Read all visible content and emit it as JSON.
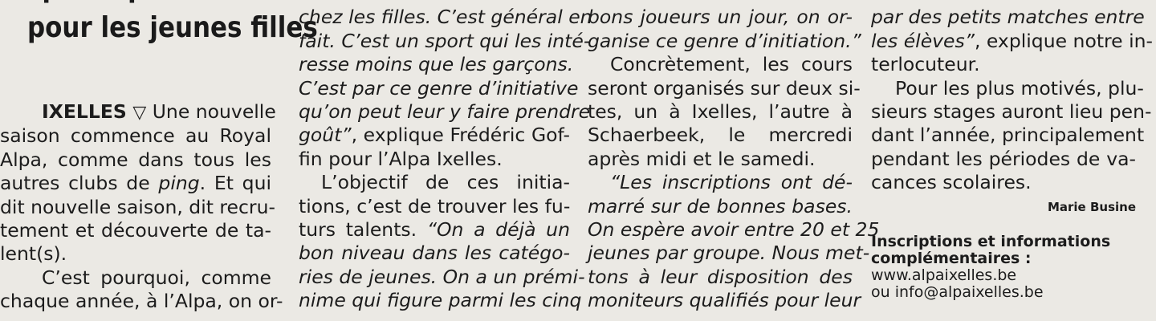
{
  "headline": [
    "spécifiques",
    "pour les jeunes filles"
  ],
  "col1": {
    "location": "IXELLES",
    "location_symbol": "▽",
    "lead_rest": " Une nouvelle",
    "lines": [
      "saison commence au Royal",
      "Alpa, comme dans tous les"
    ],
    "line_ping_pre": "autres clubs de ",
    "line_ping_em": "ping",
    "line_ping_post": ". Et qui",
    "lines2": [
      "dit nouvelle saison, dit recru-",
      "tement et découverte de ta-",
      "lent(s)."
    ],
    "para2": [
      "C’est pourquoi, comme",
      "chaque année, à l’Alpa, on or-"
    ]
  },
  "col2": {
    "lines_a": [
      "chez les filles. C’est général en",
      "fait. C’est un sport qui les inté-",
      "resse moins que les garçons.",
      "C’est par ce genre d’initiative",
      "qu’on peut leur y faire prendre"
    ],
    "quote_end_em": "goût”",
    "quote_end_post": ", explique Frédéric Gof-",
    "line_fin": "fin pour l’Alpa Ixelles.",
    "lines_b": [
      "L’objectif de ces initia-",
      "tions, c’est de trouver les fu-"
    ],
    "talents_pre": "turs talents. ",
    "talents_em": "“On a déjà un",
    "lines_c": [
      "bon niveau dans les catégo-",
      "ries de jeunes. On a un prémi-",
      "nime qui figure parmi les cinq"
    ]
  },
  "col3": {
    "lines_a": [
      "bons joueurs un jour, on or-",
      "ganise ce genre d’initiation.”"
    ],
    "lines_b": [
      "Concrètement, les cours",
      "seront organisés sur deux si-",
      "tes, un à Ixelles, l’autre à",
      "Schaerbeek, le mercredi",
      "après midi et le samedi."
    ],
    "lines_c": [
      "“Les inscriptions ont dé-",
      "marré sur de bonnes bases.",
      "On espère avoir entre 20 et 25",
      "jeunes par groupe. Nous met-",
      "tons à leur disposition des",
      "moniteurs qualifiés pour leur"
    ]
  },
  "col4": {
    "lines_a": [
      "par des petits matches entre"
    ],
    "eleves_em": "les élèves”",
    "eleves_post": ", explique notre in-",
    "line_interloc": "terlocuteur.",
    "lines_b": [
      "Pour les plus motivés, plu-",
      "sieurs stages auront lieu pen-",
      "dant l’année, principalement",
      "pendant les périodes de va-",
      "cances scolaires."
    ],
    "byline": "Marie Busine",
    "info_heading": "Inscriptions et informations complémentaires :",
    "info_lines": [
      "www.alpaixelles.be",
      "ou info@alpaixelles.be"
    ]
  },
  "colors": {
    "paper": "#ebe9e4",
    "ink": "#1c1c1c"
  }
}
